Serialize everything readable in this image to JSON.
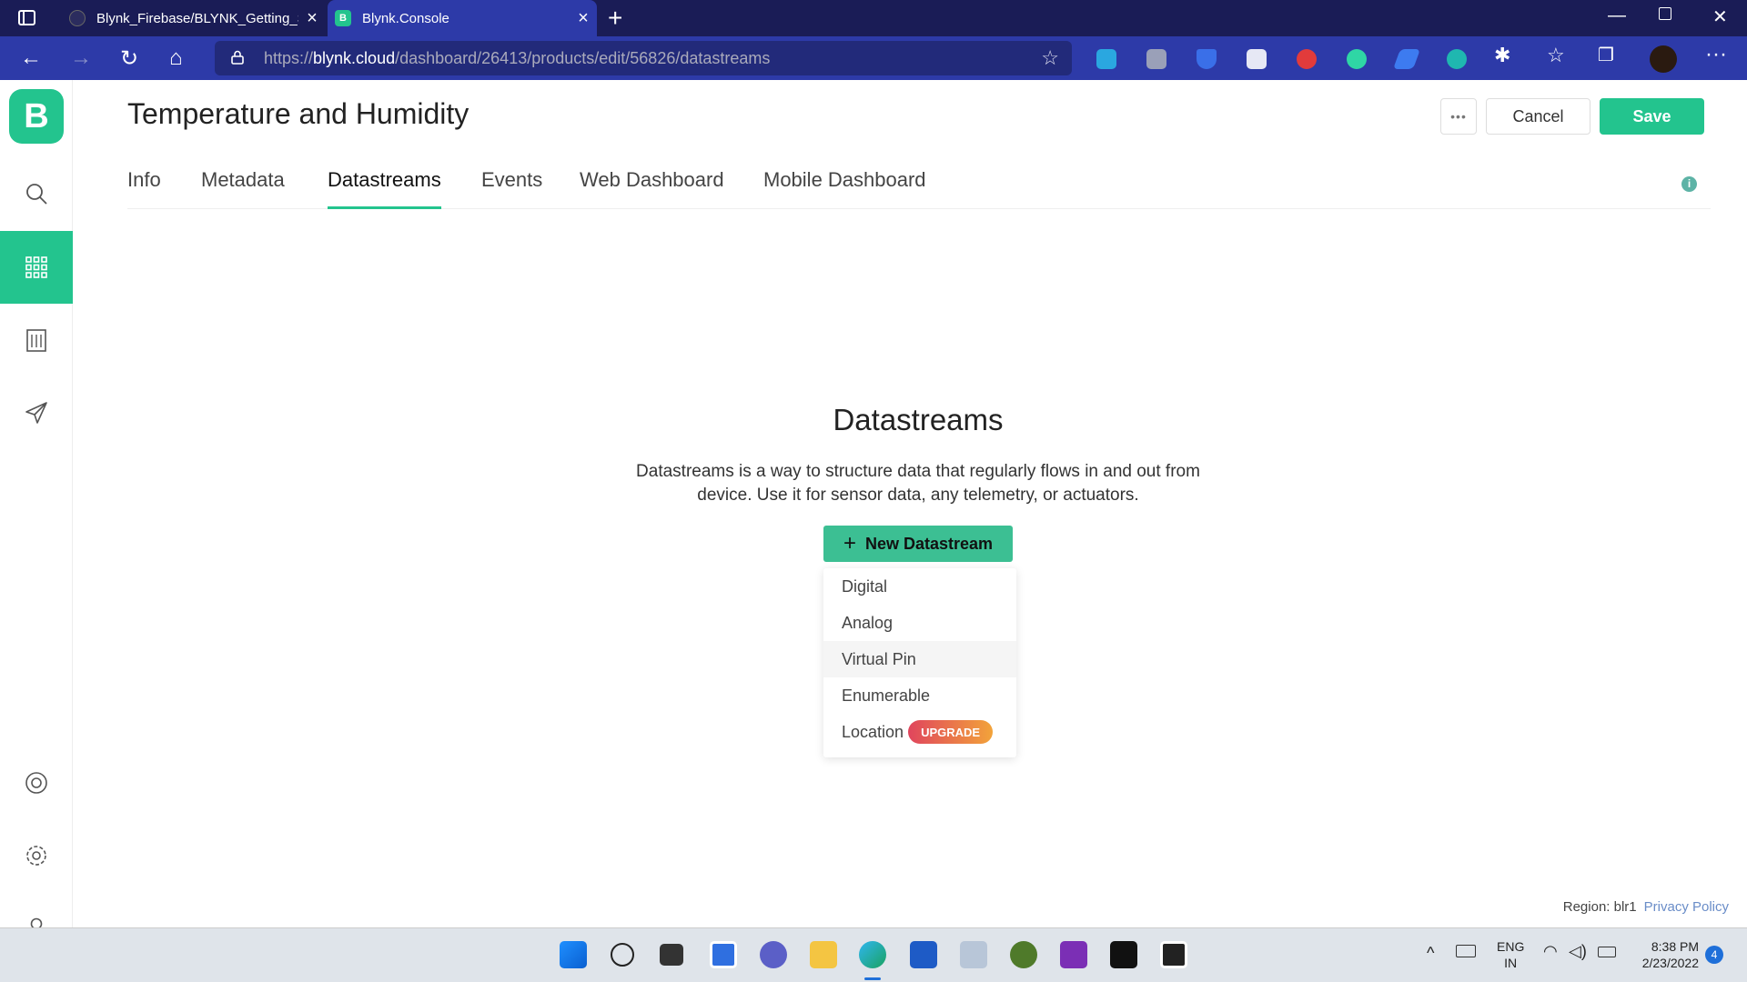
{
  "browser": {
    "tabs": [
      {
        "title": "Blynk_Firebase/BLYNK_Getting_S",
        "active": false
      },
      {
        "title": "Blynk.Console",
        "active": true,
        "favicon_letter": "B"
      }
    ],
    "url_prefix": "https://",
    "url_host": "blynk.cloud",
    "url_path": "/dashboard/26413/products/edit/56826/datastreams"
  },
  "sidebar": {
    "logo_letter": "B",
    "items": [
      "search",
      "products",
      "organizations",
      "send",
      "help",
      "settings",
      "account"
    ],
    "active": "products"
  },
  "header": {
    "title": "Temperature and Humidity",
    "more_label": "•••",
    "cancel_label": "Cancel",
    "save_label": "Save"
  },
  "tabs": [
    {
      "label": "Info",
      "active": false
    },
    {
      "label": "Metadata",
      "active": false
    },
    {
      "label": "Datastreams",
      "active": true
    },
    {
      "label": "Events",
      "active": false
    },
    {
      "label": "Web Dashboard",
      "active": false
    },
    {
      "label": "Mobile Dashboard",
      "active": false
    }
  ],
  "empty_state": {
    "title": "Datastreams",
    "description": "Datastreams is a way to structure data that regularly flows in and out from device. Use it for sensor data, any telemetry, or actuators.",
    "button_label": "New Datastream",
    "menu_items": [
      {
        "label": "Digital"
      },
      {
        "label": "Analog"
      },
      {
        "label": "Virtual Pin",
        "hovered": true
      },
      {
        "label": "Enumerable"
      },
      {
        "label": "Location",
        "badge": "UPGRADE"
      }
    ]
  },
  "footer": {
    "region": "Region: blr1",
    "privacy": "Privacy Policy"
  },
  "taskbar": {
    "language_top": "ENG",
    "language_bottom": "IN",
    "time": "8:38 PM",
    "date": "2/23/2022",
    "notification_count": "4"
  },
  "colors": {
    "accent": "#23c48e",
    "browser_dark": "#1a1c56",
    "browser_bar": "#2d3aa8"
  }
}
